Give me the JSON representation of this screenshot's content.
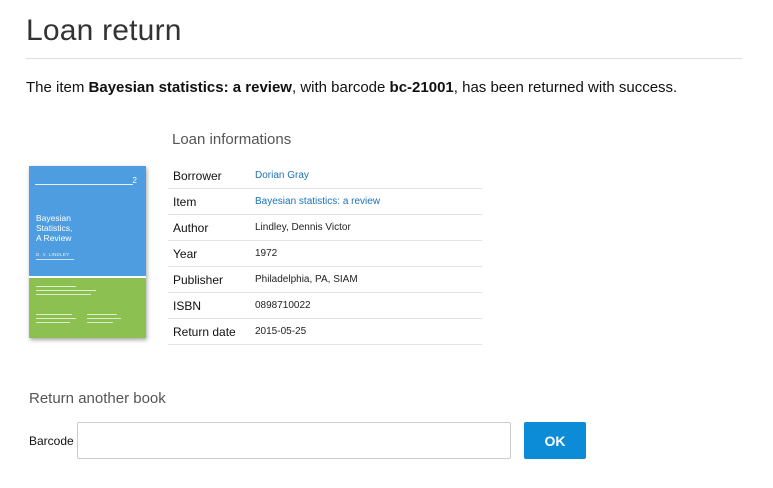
{
  "page": {
    "title": "Loan return"
  },
  "message": {
    "prefix": "The item ",
    "item_title": "Bayesian statistics: a review",
    "middle": ", with barcode ",
    "barcode": "bc-21001",
    "suffix": ", has been returned with success."
  },
  "loan_info": {
    "heading": "Loan informations",
    "rows": [
      {
        "label": "Borrower",
        "value": "Dorian Gray",
        "link": true
      },
      {
        "label": "Item",
        "value": "Bayesian statistics: a review",
        "link": true
      },
      {
        "label": "Author",
        "value": "Lindley, Dennis Victor",
        "link": false
      },
      {
        "label": "Year",
        "value": "1972",
        "link": false
      },
      {
        "label": "Publisher",
        "value": "Philadelphia, PA, SIAM",
        "link": false
      },
      {
        "label": "ISBN",
        "value": "0898710022",
        "link": false
      },
      {
        "label": "Return date",
        "value": "2015-05-25",
        "link": false
      }
    ]
  },
  "cover": {
    "number": "2",
    "title_line1": "Bayesian",
    "title_line2": "Statistics,",
    "title_line3": "A Review",
    "author": "D. V. LINDLEY",
    "top_color": "#4e9de0",
    "bottom_color": "#8cc152"
  },
  "return_form": {
    "heading": "Return another book",
    "barcode_label": "Barcode",
    "barcode_value": "",
    "submit_label": "OK"
  },
  "colors": {
    "link": "#1a73b8",
    "button": "#0c8bd6"
  }
}
